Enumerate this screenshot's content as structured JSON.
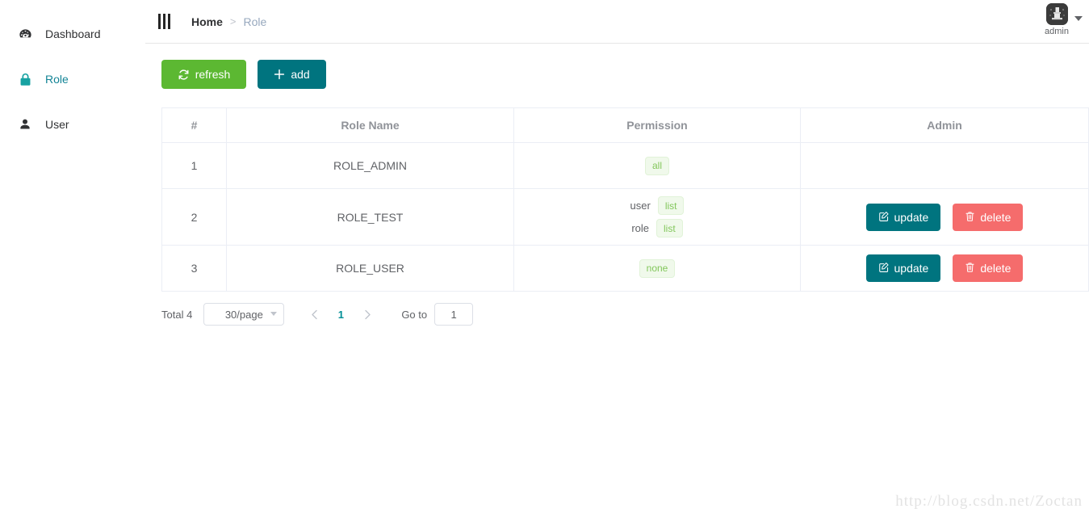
{
  "sidebar": {
    "items": [
      {
        "label": "Dashboard",
        "icon": "dashboard-icon",
        "active": false
      },
      {
        "label": "Role",
        "icon": "lock-icon",
        "active": true
      },
      {
        "label": "User",
        "icon": "user-icon",
        "active": false
      }
    ]
  },
  "header": {
    "collapse_icon": "collapse-menu-icon",
    "breadcrumb": {
      "home": "Home",
      "separator": ">",
      "current": "Role"
    },
    "user": {
      "name": "admin",
      "avatar_icon": "avatar-icon",
      "caret_icon": "caret-down-icon"
    }
  },
  "toolbar": {
    "refresh_label": "refresh",
    "refresh_icon": "refresh-icon",
    "refresh_color": "#5cb832",
    "add_label": "add",
    "add_icon": "plus-icon",
    "add_color": "#00747f"
  },
  "table": {
    "columns": [
      "#",
      "Role Name",
      "Permission",
      "Admin"
    ],
    "rows": [
      {
        "index": "1",
        "role_name": "ROLE_ADMIN",
        "permissions": [
          {
            "key": "",
            "tag": "all"
          }
        ],
        "actions": []
      },
      {
        "index": "2",
        "role_name": "ROLE_TEST",
        "permissions": [
          {
            "key": "user",
            "tag": "list"
          },
          {
            "key": "role",
            "tag": "list"
          }
        ],
        "actions": [
          {
            "label": "update",
            "icon": "edit-icon",
            "color": "#00747f"
          },
          {
            "label": "delete",
            "icon": "trash-icon",
            "color": "#f56c6c"
          }
        ]
      },
      {
        "index": "3",
        "role_name": "ROLE_USER",
        "permissions": [
          {
            "key": "",
            "tag": "none"
          }
        ],
        "actions": [
          {
            "label": "update",
            "icon": "edit-icon",
            "color": "#00747f"
          },
          {
            "label": "delete",
            "icon": "trash-icon",
            "color": "#f56c6c"
          }
        ]
      }
    ],
    "tag_color": "#83c75c",
    "tag_bg": "#f0f9eb"
  },
  "pagination": {
    "total_label": "Total 4",
    "page_size": "30/page",
    "prev_icon": "chevron-left-icon",
    "next_icon": "chevron-right-icon",
    "current_page": "1",
    "goto_label": "Go to",
    "goto_value": "1"
  },
  "watermark": "http://blog.csdn.net/Zoctan"
}
